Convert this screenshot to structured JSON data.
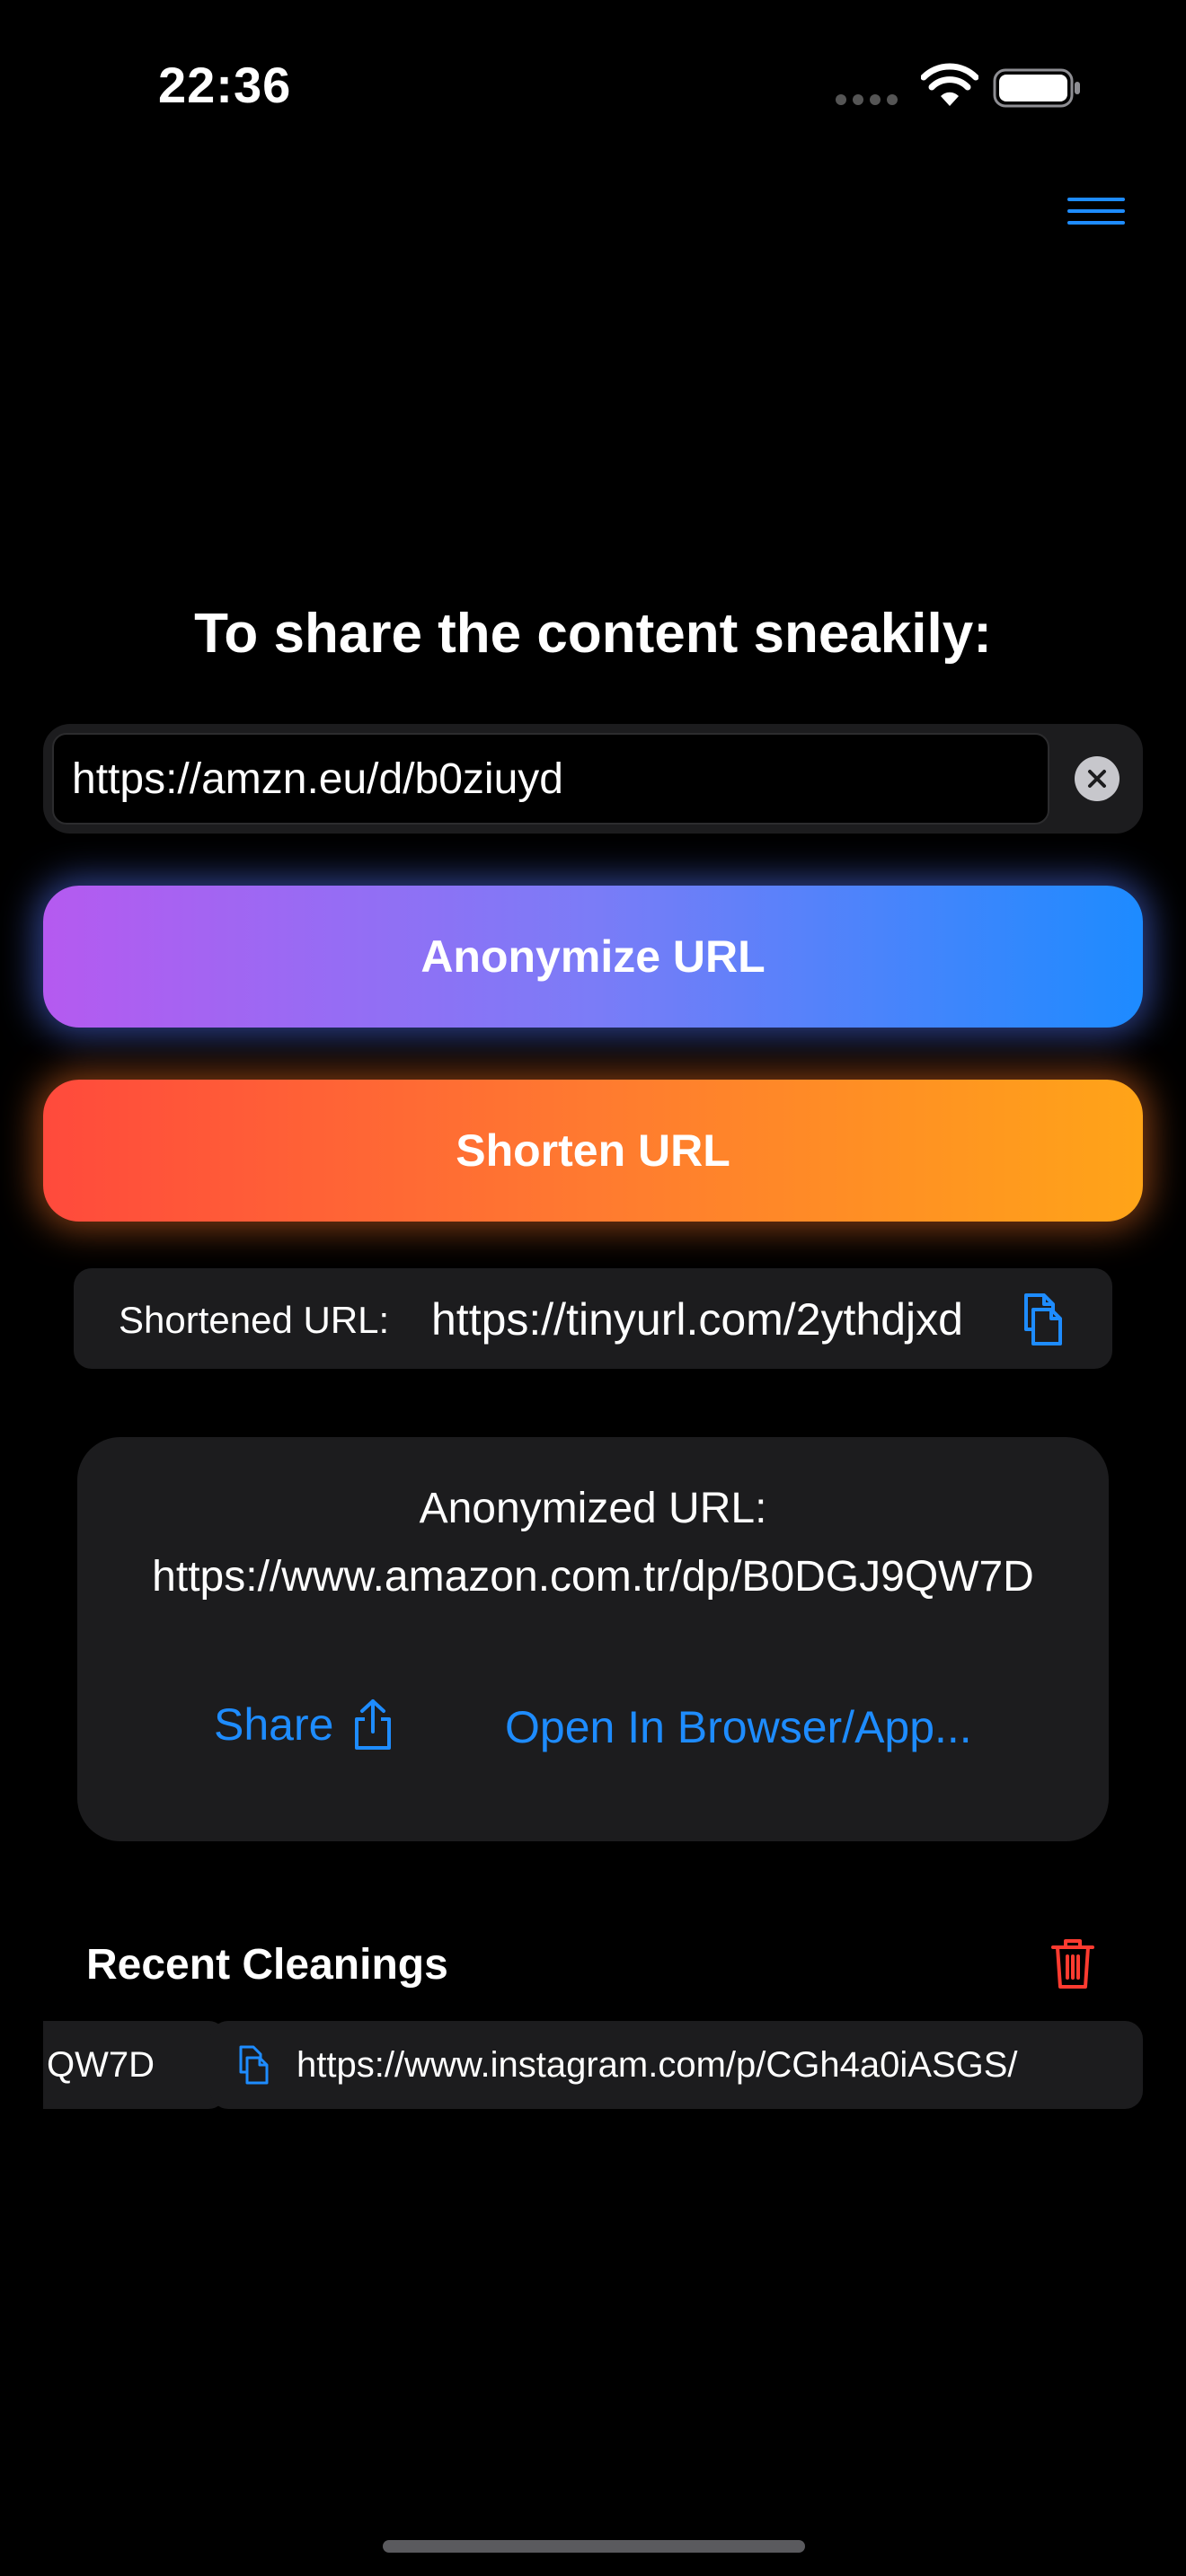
{
  "status_bar": {
    "time": "22:36"
  },
  "heading": "To share the content sneakily:",
  "input": {
    "value": "https://amzn.eu/d/b0ziuyd"
  },
  "buttons": {
    "anonymize": "Anonymize URL",
    "shorten": "Shorten URL"
  },
  "shortened": {
    "label": "Shortened URL:",
    "value": "https://tinyurl.com/2ythdjxd"
  },
  "anonymized": {
    "label": "Anonymized URL:",
    "value": "https://www.amazon.com.tr/dp/B0DGJ9QW7D",
    "share_label": "Share",
    "open_label": "Open In Browser/App..."
  },
  "recent": {
    "title": "Recent Cleanings",
    "items": [
      {
        "text": "QW7D"
      },
      {
        "text": "https://www.instagram.com/p/CGh4a0iASGS/"
      }
    ]
  },
  "colors": {
    "accent_blue": "#1e8cff",
    "danger_red": "#ff3b30",
    "card_bg": "#1c1c1e"
  }
}
